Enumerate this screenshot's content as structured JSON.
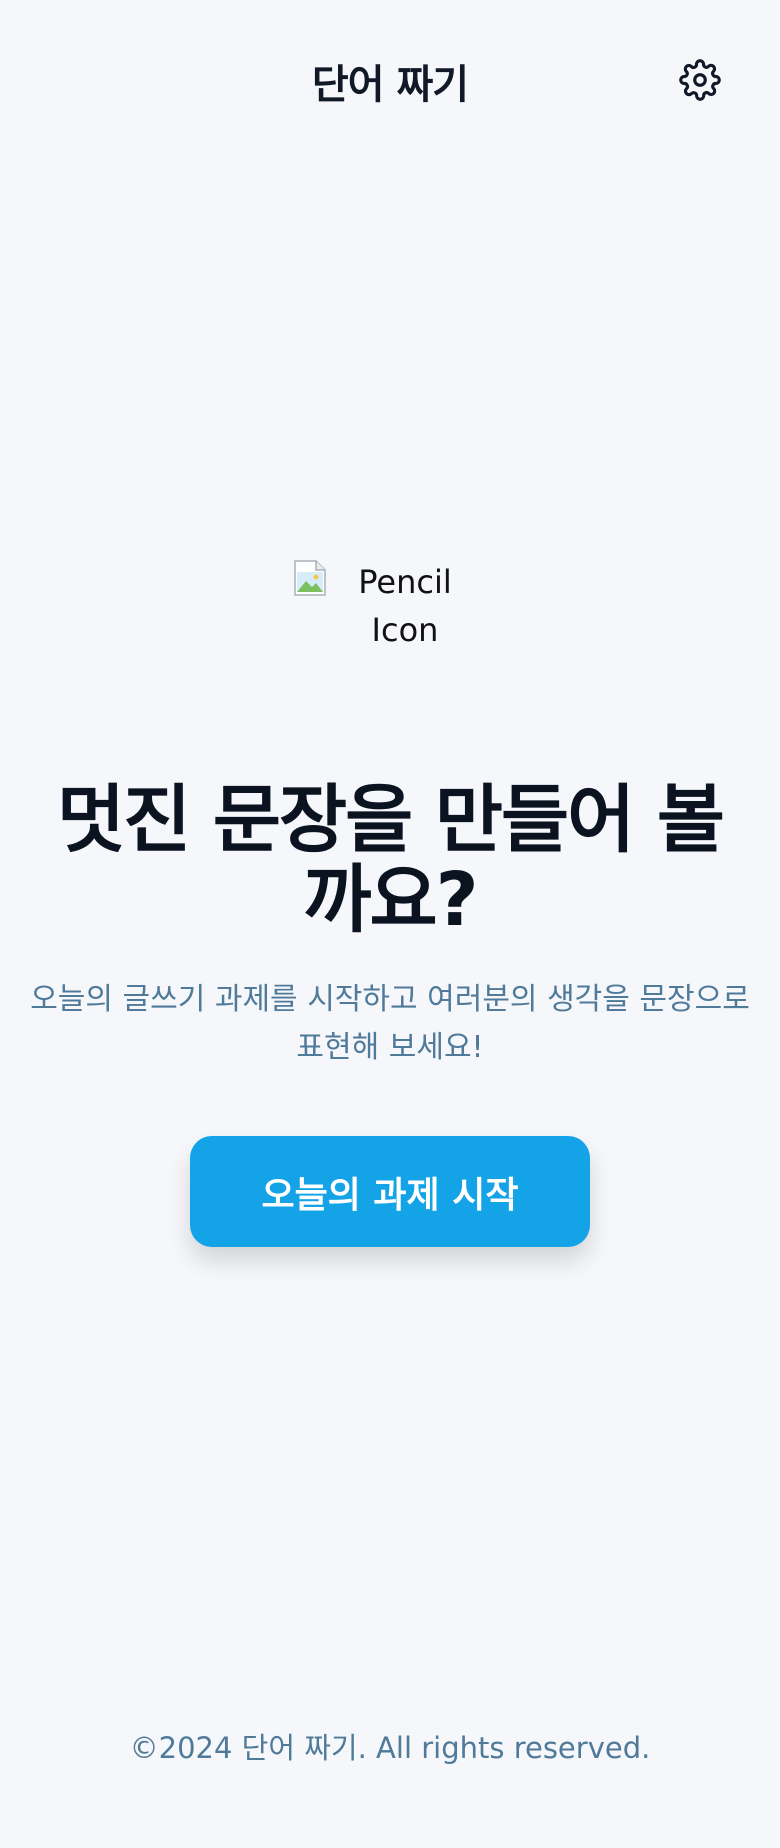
{
  "header": {
    "title": "단어 짜기",
    "settings_icon": "gear-icon"
  },
  "hero": {
    "icon_alt": "Pencil Icon",
    "icon_name": "broken-image-icon",
    "headline": "멋진 문장을 만들어 볼까요?",
    "subtitle": "오늘의 글쓰기 과제를 시작하고 여러분의 생각을 문장으로 표현해 보세요!",
    "cta_label": "오늘의 과제 시작"
  },
  "footer": {
    "copyright": "©2024 단어 짜기. All rights reserved."
  },
  "colors": {
    "background": "#f5f7fa",
    "accent": "#15a3e8",
    "text_primary": "#0b1220",
    "text_secondary": "#4f7a99"
  }
}
